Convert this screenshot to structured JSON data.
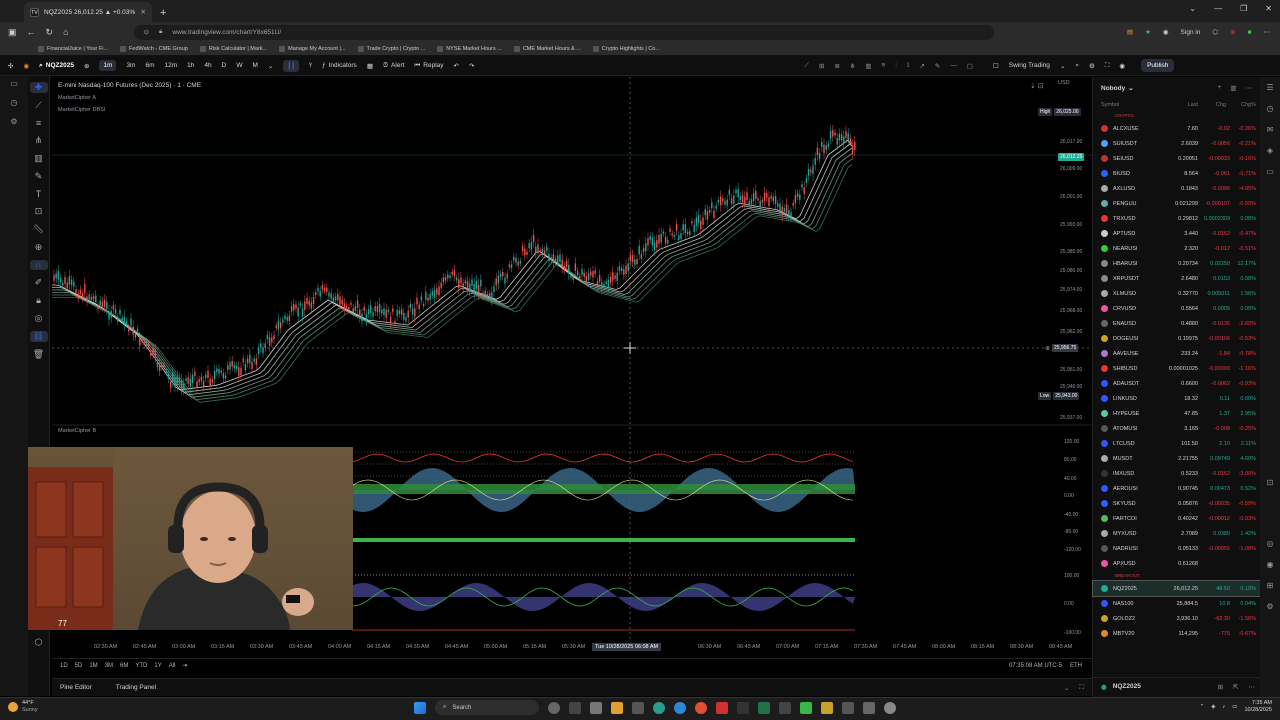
{
  "browser": {
    "tab_title": "NQZ2025 26,012.25 ▲ +0.03%",
    "tab_icon_text": "TV",
    "url": "www.tradingview.com/chart/Y8x651U/",
    "signin": "Sign in",
    "bookmarks": [
      "FinancialJuice | Your Fi...",
      "FedWatch - CME Group",
      "Risk Calculator | Mark...",
      "Manage My Account |...",
      "Trade Crypto | Crypto ...",
      "NYSE Market Hours ...",
      "CME Market Hours & ...",
      "Crypto Highlights | Co..."
    ]
  },
  "toolbar": {
    "symbol": "NQZ2025",
    "intervals": [
      "1m",
      "3m",
      "6m",
      "12m",
      "1h",
      "4h",
      "D",
      "W",
      "M"
    ],
    "active_interval": "1m",
    "indicators": "Indicators",
    "alert": "Alert",
    "replay": "Replay",
    "layout_name": "Swing Trading",
    "publish": "Publish"
  },
  "chart": {
    "title": "E-mini Nasdaq-100 Futures (Dec 2025) · 1 · CME",
    "indicator_a": "MarketCipher A",
    "indicator_dbsi": "MarketCipher DBSI",
    "indicator_b": "MarketCipher B",
    "currency": "USD",
    "high_label": "High",
    "high_value": "26,025.00",
    "low_label": "Low",
    "low_value": "25,943.00",
    "current_price": "26,012.25",
    "crosshair_price": "25,956.75",
    "price_ticks": [
      "26,017.00",
      "26,009.00",
      "26,001.00",
      "25,993.00",
      "25,985.00",
      "25,980.00",
      "25,974.00",
      "25,968.00",
      "25,962.00",
      "25,951.00",
      "25,946.00",
      "25,937.00"
    ],
    "osc_ticks": [
      "120.00",
      "80.00",
      "40.00",
      "0.00",
      "-40.00",
      "-80.00",
      "-120.00",
      "100.00",
      "0.00",
      "-100.00"
    ],
    "time_ticks": [
      "02:30 AM",
      "02:45 AM",
      "03:00 AM",
      "03:15 AM",
      "03:30 AM",
      "03:45 AM",
      "04:00 AM",
      "04:15 AM",
      "04:30 AM",
      "04:45 AM",
      "05:00 AM",
      "05:15 AM",
      "05:30 AM",
      "05:45 AM",
      "06:30 AM",
      "06:45 AM",
      "07:00 AM",
      "07:15 AM",
      "07:30 AM",
      "07:45 AM",
      "08:00 AM",
      "08:15 AM",
      "08:30 AM",
      "08:45 AM"
    ],
    "crosshair_time": "Tue 10/28/2025  06:08 AM",
    "ranges": [
      "1D",
      "5D",
      "1M",
      "3M",
      "6M",
      "YTD",
      "1Y",
      "All"
    ],
    "clock": "07:35:08 AM UTC-5",
    "session": "ETH",
    "webcam_overlay_text": "77"
  },
  "bottom_tabs": {
    "pine_editor": "Pine Editor",
    "trading_panel": "Trading Panel"
  },
  "watchlist": {
    "name": "Nobody",
    "columns": {
      "symbol": "Symbol",
      "last": "Last",
      "chg": "Chg",
      "chgp": "Chg%"
    },
    "section_crypto": "CRYPTO",
    "section_breakout": "BREAKOUT",
    "crypto": [
      {
        "s": "ALCXUSE",
        "l": "7.60",
        "c": "-0.02",
        "p": "-0.26%",
        "d": "neg",
        "col": "#c33"
      },
      {
        "s": "SUIUSDT",
        "l": "2.6039",
        "c": "-0.0056",
        "p": "-0.21%",
        "d": "neg",
        "col": "#4da3ff"
      },
      {
        "s": "SEIUSD",
        "l": "0.20051",
        "c": "-0.00033",
        "p": "-0.16%",
        "d": "neg",
        "col": "#b33"
      },
      {
        "s": "BIUSD",
        "l": "8.564",
        "c": "-0.061",
        "p": "-0.71%",
        "d": "neg",
        "col": "#2962ff"
      },
      {
        "s": "AXLUSD",
        "l": "0.1843",
        "c": "-0.0096",
        "p": "-4.95%",
        "d": "neg",
        "col": "#aaa"
      },
      {
        "s": "PENGUU",
        "l": "0.021299",
        "c": "-0.000107",
        "p": "-0.50%",
        "d": "neg",
        "col": "#6aa"
      },
      {
        "s": "TRXUSD",
        "l": "0.29812",
        "c": "0.0002309",
        "p": "0.08%",
        "d": "pos",
        "col": "#e33"
      },
      {
        "s": "APTUSD",
        "l": "3.440",
        "c": "-0.0162",
        "p": "-0.47%",
        "d": "neg",
        "col": "#ccc"
      },
      {
        "s": "NEARUSI",
        "l": "2.320",
        "c": "-0.012",
        "p": "-0.51%",
        "d": "neg",
        "col": "#3c3"
      },
      {
        "s": "HBARUSI",
        "l": "0.20734",
        "c": "0.02250",
        "p": "12.17%",
        "d": "pos",
        "col": "#888"
      },
      {
        "s": "XRPUSDT",
        "l": "2.6480",
        "c": "0.0153",
        "p": "0.58%",
        "d": "pos",
        "col": "#888"
      },
      {
        "s": "XLMUSD",
        "l": "0.32770",
        "c": "0.005011",
        "p": "1.56%",
        "d": "pos",
        "col": "#aaa"
      },
      {
        "s": "CRVUSD",
        "l": "0.5564",
        "c": "0.0005",
        "p": "0.09%",
        "d": "pos",
        "col": "#e5a"
      },
      {
        "s": "ENAUSD",
        "l": "0.4880",
        "c": "-0.0135",
        "p": "-2.69%",
        "d": "neg",
        "col": "#666"
      },
      {
        "s": "DOGEUSI",
        "l": "0.19975",
        "c": "-0.00106",
        "p": "-0.53%",
        "d": "neg",
        "col": "#c9a227"
      },
      {
        "s": "AAVEUSE",
        "l": "233.24",
        "c": "-1.84",
        "p": "-0.78%",
        "d": "neg",
        "col": "#a7c"
      },
      {
        "s": "SHIBUSD",
        "l": "0.00001025",
        "c": "-0.00000",
        "p": "-1.16%",
        "d": "neg",
        "col": "#e33"
      },
      {
        "s": "ADAUSDT",
        "l": "0.6600",
        "c": "-0.0062",
        "p": "-0.93%",
        "d": "neg",
        "col": "#35f"
      },
      {
        "s": "LINKUSD",
        "l": "18.32",
        "c": "0.11",
        "p": "0.60%",
        "d": "pos",
        "col": "#35f"
      },
      {
        "s": "HYPEUSE",
        "l": "47.85",
        "c": "1.37",
        "p": "2.95%",
        "d": "pos",
        "col": "#5c9"
      },
      {
        "s": "ATOMUSI",
        "l": "3.165",
        "c": "-0.008",
        "p": "-0.25%",
        "d": "neg",
        "col": "#555"
      },
      {
        "s": "LTCUSD",
        "l": "101.50",
        "c": "2.10",
        "p": "2.11%",
        "d": "pos",
        "col": "#35f"
      },
      {
        "s": "MUSDT",
        "l": "2.21755",
        "c": "0.09749",
        "p": "4.60%",
        "d": "pos",
        "col": "#aaa"
      },
      {
        "s": "IMXUSD",
        "l": "0.5233",
        "c": "-0.0162",
        "p": "-3.00%",
        "d": "neg",
        "col": "#333"
      },
      {
        "s": "AEROUSI",
        "l": "0.90745",
        "c": "0.00473",
        "p": "0.52%",
        "d": "pos",
        "col": "#35f"
      },
      {
        "s": "SKYUSD",
        "l": "0.05876",
        "c": "-0.00035",
        "p": "-0.59%",
        "d": "neg",
        "col": "#2962ff"
      },
      {
        "s": "FARTCOI",
        "l": "0.40242",
        "c": "-0.00012",
        "p": "-0.03%",
        "d": "neg",
        "col": "#5b5"
      },
      {
        "s": "MYXUSD",
        "l": "2.7089",
        "c": "0.0380",
        "p": "1.42%",
        "d": "pos",
        "col": "#aaa"
      },
      {
        "s": "NADRUSI",
        "l": "0.05133",
        "c": "-0.00056",
        "p": "-1.08%",
        "d": "neg",
        "col": "#555"
      },
      {
        "s": "APXUSD",
        "l": "0.61268",
        "c": "",
        "p": "",
        "d": "pos",
        "col": "#e5a"
      }
    ],
    "breakout": [
      {
        "s": "NQZ2025",
        "l": "26,012.25",
        "c": "48.50",
        "p": "0.19%",
        "d": "pos",
        "col": "#22ab94",
        "hl": true
      },
      {
        "s": "NAS100",
        "l": "25,884.5",
        "c": "10.8",
        "p": "0.04%",
        "d": "pos",
        "col": "#35f"
      },
      {
        "s": "GOLDZ2",
        "l": "3,936.10",
        "c": "-62.30",
        "p": "-1.56%",
        "d": "neg",
        "col": "#c9a227"
      },
      {
        "s": "MBTV20",
        "l": "114,295",
        "c": "-775",
        "p": "-0.67%",
        "d": "neg",
        "col": "#e08b2a"
      }
    ],
    "footer_symbol": "NQZ2025"
  },
  "taskbar": {
    "temp": "44°F",
    "condition": "Sunny",
    "search": "Search",
    "time": "7:35 AM",
    "date": "10/28/2025"
  }
}
